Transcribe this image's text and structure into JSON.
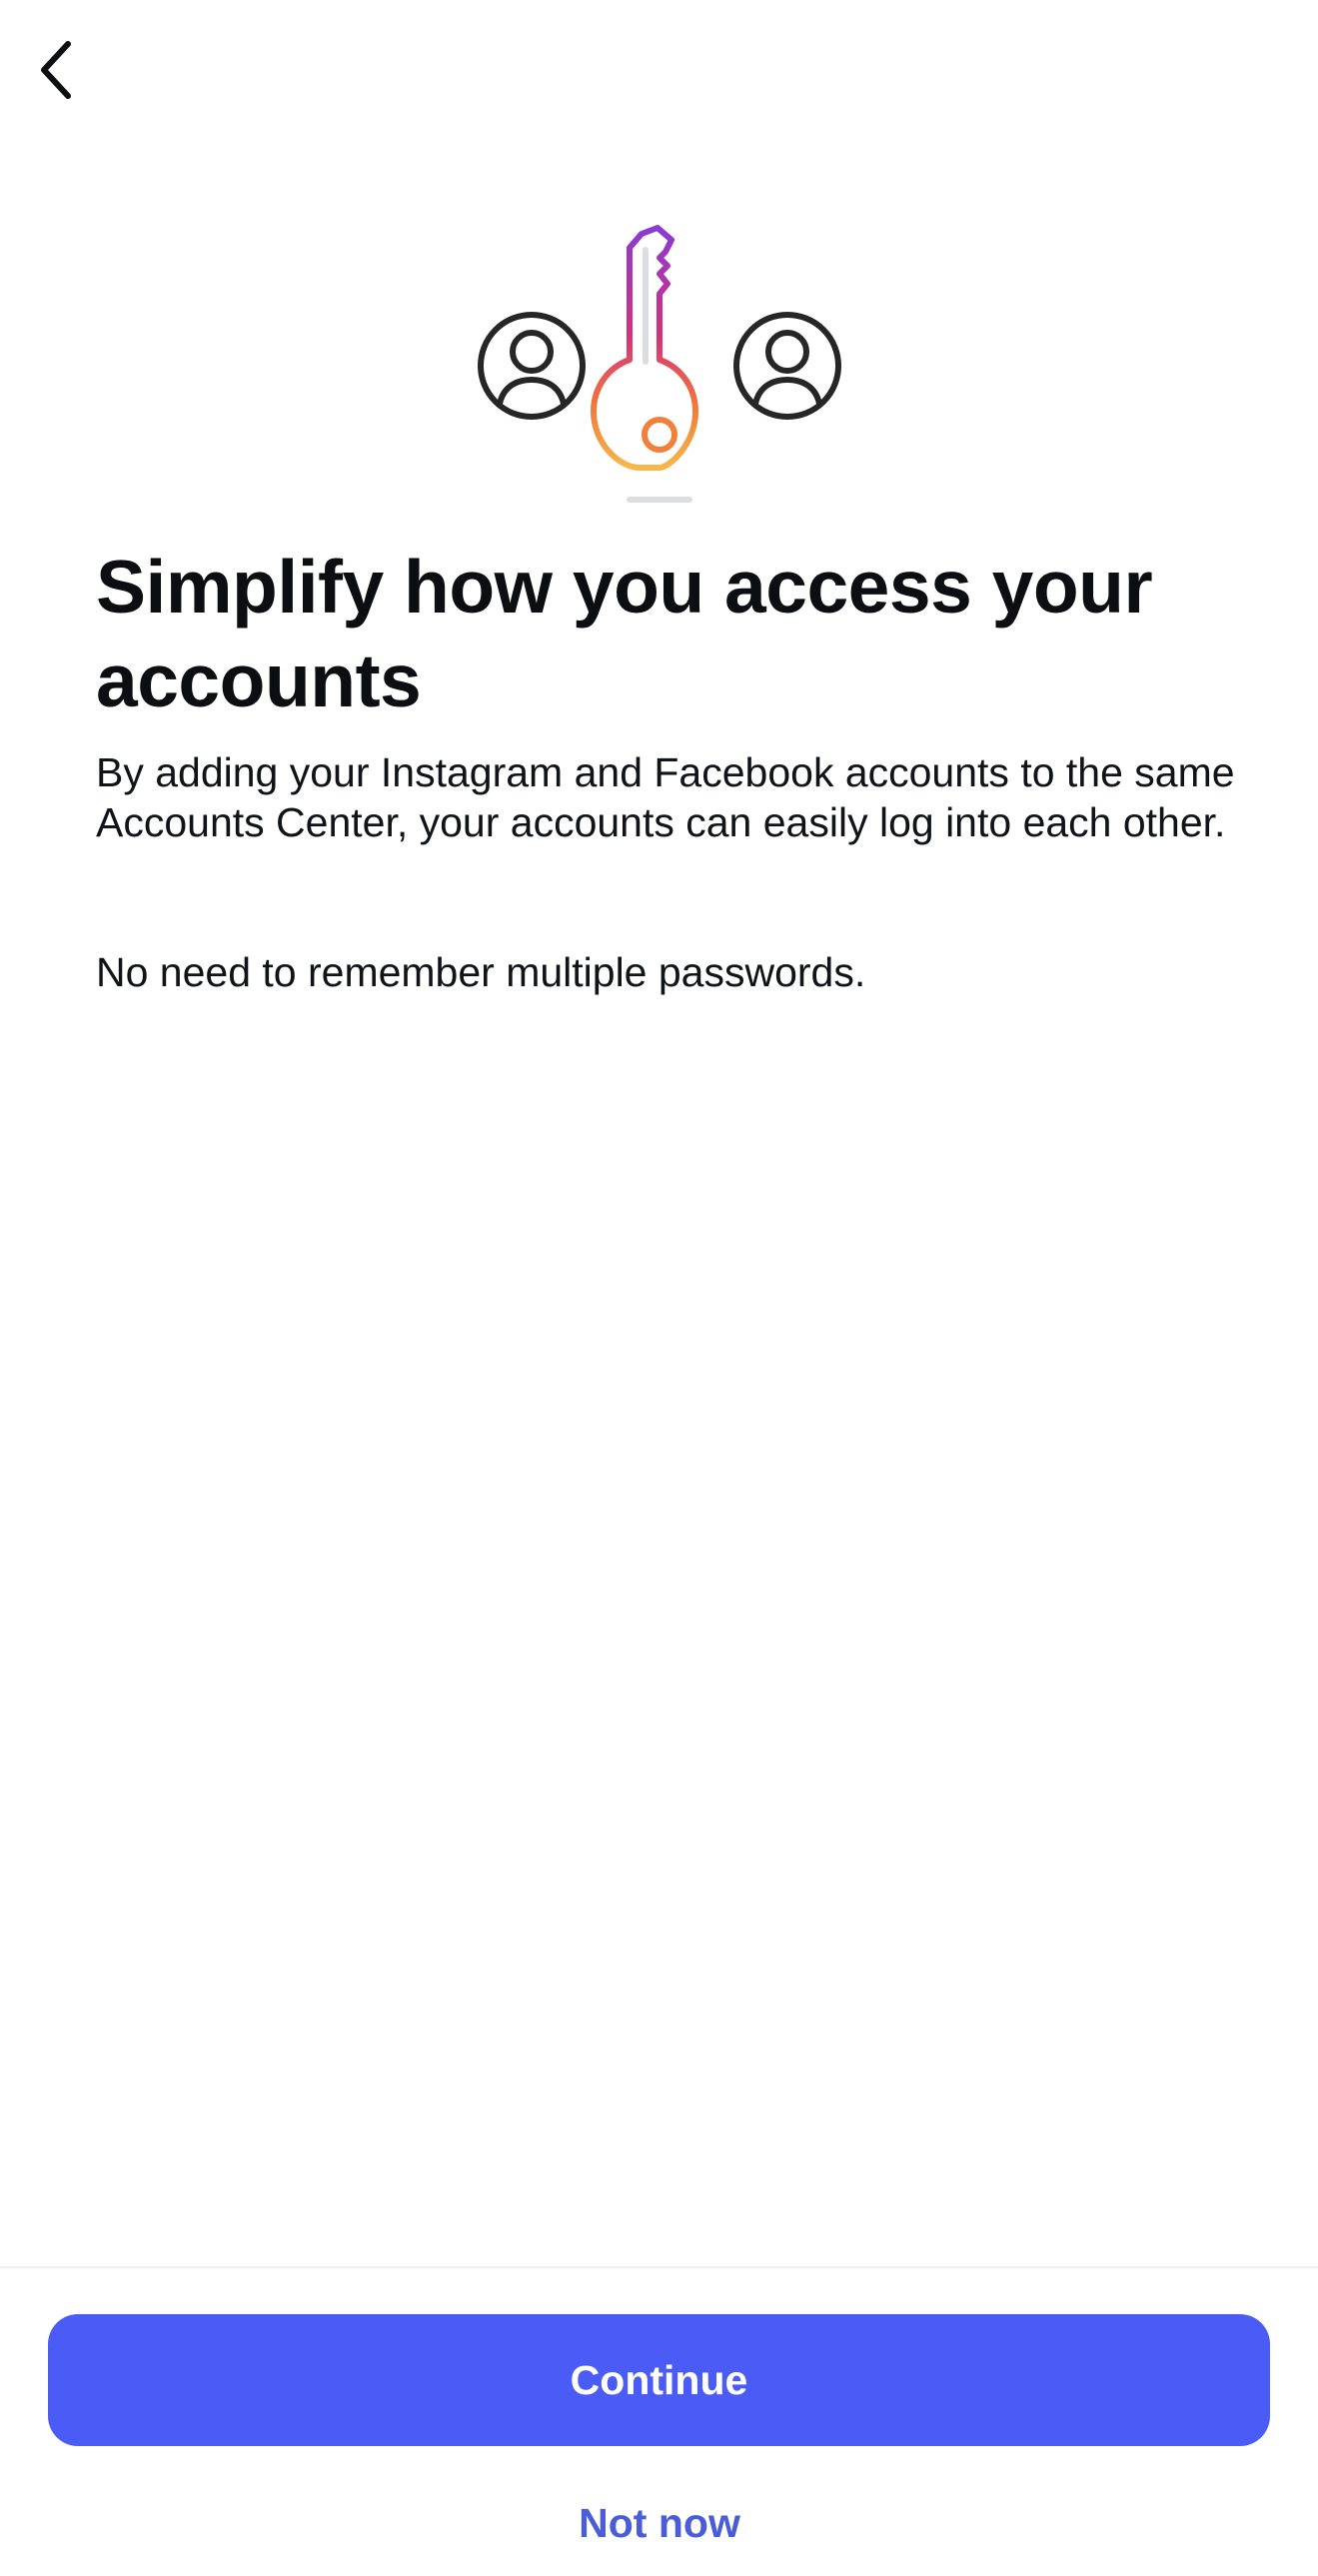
{
  "header": {
    "back_icon": "chevron-left-icon"
  },
  "illustration": {
    "icons": [
      "user-circle-icon",
      "key-icon",
      "user-circle-icon"
    ],
    "gradient_colors": [
      "#8a3ad6",
      "#d6307a",
      "#f07a3a",
      "#f7b84a"
    ],
    "user_icon_color": "#262626"
  },
  "content": {
    "title": "Simplify how you access your accounts",
    "paragraph_1": "By adding your Instagram and Facebook accounts to the same Accounts Center, your accounts can easily log into each other.",
    "paragraph_2": "No need to remember multiple passwords."
  },
  "footer": {
    "continue_label": "Continue",
    "not_now_label": "Not now",
    "accent_color": "#4a5cf5"
  }
}
